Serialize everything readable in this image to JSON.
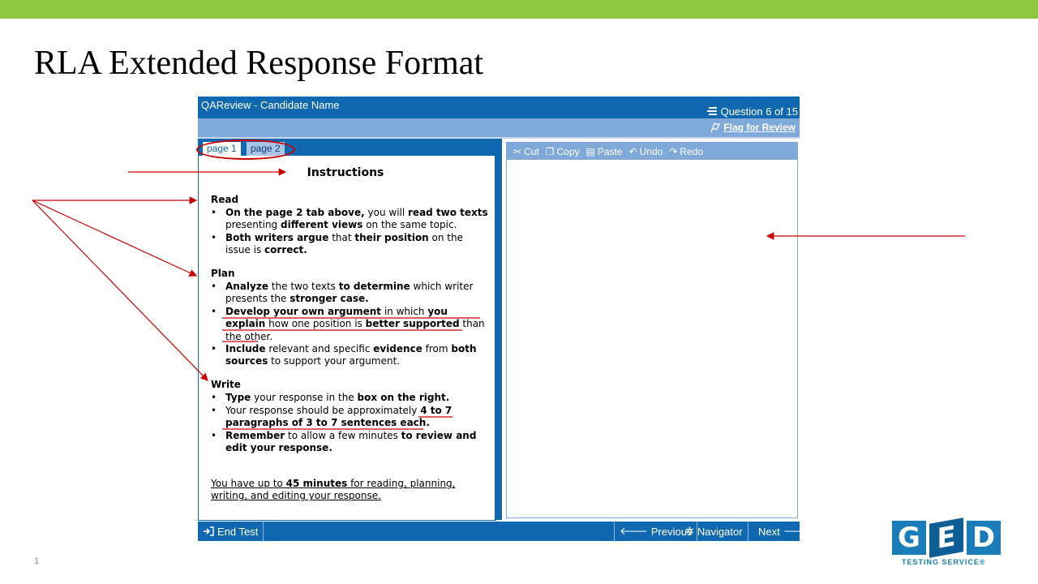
{
  "slide": {
    "title": "RLA Extended Response Format",
    "page_number": "1",
    "accent_color": "#8dc63f"
  },
  "app": {
    "title": "QAReview - Candidate Name",
    "question_counter": "Question 6 of 15",
    "flag_label": "Flag for Review",
    "header_color": "#1068b0",
    "tabs": [
      {
        "label": "page 1",
        "active": true
      },
      {
        "label": "page 2",
        "active": false
      }
    ],
    "instructions": {
      "title": "Instructions",
      "sections": [
        {
          "heading": "Read",
          "bullets": [
            "On the page 2 tab above, you will read two texts presenting different views on the same topic.",
            "Both writers argue that their position on the issue is correct."
          ]
        },
        {
          "heading": "Plan",
          "bullets": [
            "Analyze the two texts to determine which writer presents the stronger case.",
            "Develop your own argument in which you explain how one position is better supported than the other.",
            "Include relevant and specific evidence from both sources to support your argument."
          ]
        },
        {
          "heading": "Write",
          "bullets": [
            "Type your response in the box on the right.",
            "Your response should be approximately 4 to 7 paragraphs of 3 to 7 sentences each.",
            "Remember to allow a few minutes to review and edit your response."
          ]
        }
      ],
      "time_note": "You have up to 45 minutes for reading, planning, writing, and editing your response."
    },
    "editor": {
      "toolbar": [
        "Cut",
        "Copy",
        "Paste",
        "Undo",
        "Redo"
      ],
      "response_text": ""
    },
    "footer": {
      "end_test": "End Test",
      "previous": "Previous",
      "navigator": "Navigator",
      "next": "Next"
    }
  },
  "logo": {
    "letters": [
      "G",
      "E",
      "D"
    ],
    "tagline": "TESTING SERVICE®",
    "color": "#1a7cb8"
  },
  "icons": {
    "question": "list-icon",
    "flag": "flag-icon",
    "cut": "scissors-icon",
    "copy": "copy-icon",
    "paste": "clipboard-icon",
    "undo": "undo-icon",
    "redo": "redo-icon",
    "end_test": "exit-icon",
    "previous": "arrow-left-icon",
    "navigator": "navigator-icon",
    "next": "arrow-right-icon"
  }
}
